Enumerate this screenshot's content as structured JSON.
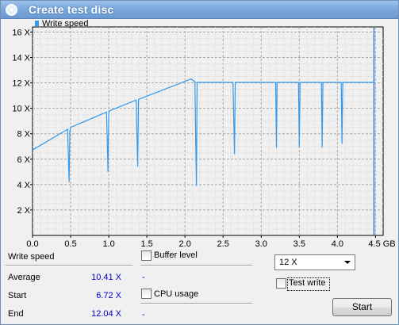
{
  "window": {
    "title": "Create test disc",
    "title_icon": "disc-icon"
  },
  "chart_data": {
    "type": "line",
    "legend": [
      "Write speed"
    ],
    "legend_placement": "top-left",
    "xlabel": "",
    "ylabel": "",
    "x_ticks": [
      "0.0",
      "0.5",
      "1.0",
      "1.5",
      "2.0",
      "2.5",
      "3.0",
      "3.5",
      "4.0",
      "4.5 GB"
    ],
    "y_ticks": [
      "2 X",
      "4 X",
      "6 X",
      "8 X",
      "10 X",
      "12 X",
      "14 X",
      "16 X"
    ],
    "xlim": [
      0,
      4.6
    ],
    "ylim": [
      0,
      16.4
    ],
    "grid": true,
    "series": [
      {
        "name": "Write speed",
        "color": "#3399ee",
        "x": [
          0.0,
          0.46,
          0.47,
          0.48,
          0.49,
          0.5,
          0.97,
          0.98,
          0.99,
          1.0,
          1.01,
          1.36,
          1.37,
          1.38,
          1.39,
          2.08,
          2.13,
          2.14,
          2.15,
          2.16,
          2.63,
          2.64,
          2.65,
          2.66,
          3.19,
          3.2,
          3.21,
          3.22,
          3.49,
          3.5,
          3.51,
          3.52,
          3.79,
          3.8,
          3.81,
          3.82,
          4.05,
          4.06,
          4.07,
          4.08,
          4.48
        ],
        "y": [
          6.72,
          8.35,
          6.2,
          4.2,
          8.25,
          8.5,
          9.7,
          7.6,
          5.0,
          9.6,
          9.8,
          10.65,
          8.0,
          5.4,
          10.7,
          12.3,
          12.1,
          8.0,
          3.9,
          12.04,
          12.04,
          9.0,
          6.4,
          12.04,
          12.04,
          6.9,
          12.04,
          12.04,
          12.04,
          6.9,
          12.04,
          12.04,
          12.04,
          6.9,
          12.04,
          12.04,
          12.04,
          7.2,
          12.04,
          12.04,
          12.04
        ]
      }
    ],
    "marker_line": {
      "x": 4.48,
      "color": "#3380d0"
    }
  },
  "stats": {
    "heading": "Write speed",
    "rows": [
      {
        "label": "Average",
        "value": "10.41 X"
      },
      {
        "label": "Start",
        "value": "6.72 X"
      },
      {
        "label": "End",
        "value": "12.04 X"
      }
    ],
    "buffer_level": {
      "label": "Buffer level",
      "checked": false,
      "value": "-"
    },
    "cpu_usage": {
      "label": "CPU usage",
      "checked": false,
      "value": "-"
    }
  },
  "controls": {
    "speed_select": {
      "selected": "12 X"
    },
    "test_write": {
      "label": "Test write",
      "checked": false
    },
    "start_button": "Start"
  },
  "colors": {
    "value_text": "#0000c8",
    "title_bar": "#7ca9dd",
    "series": "#3399ee"
  }
}
